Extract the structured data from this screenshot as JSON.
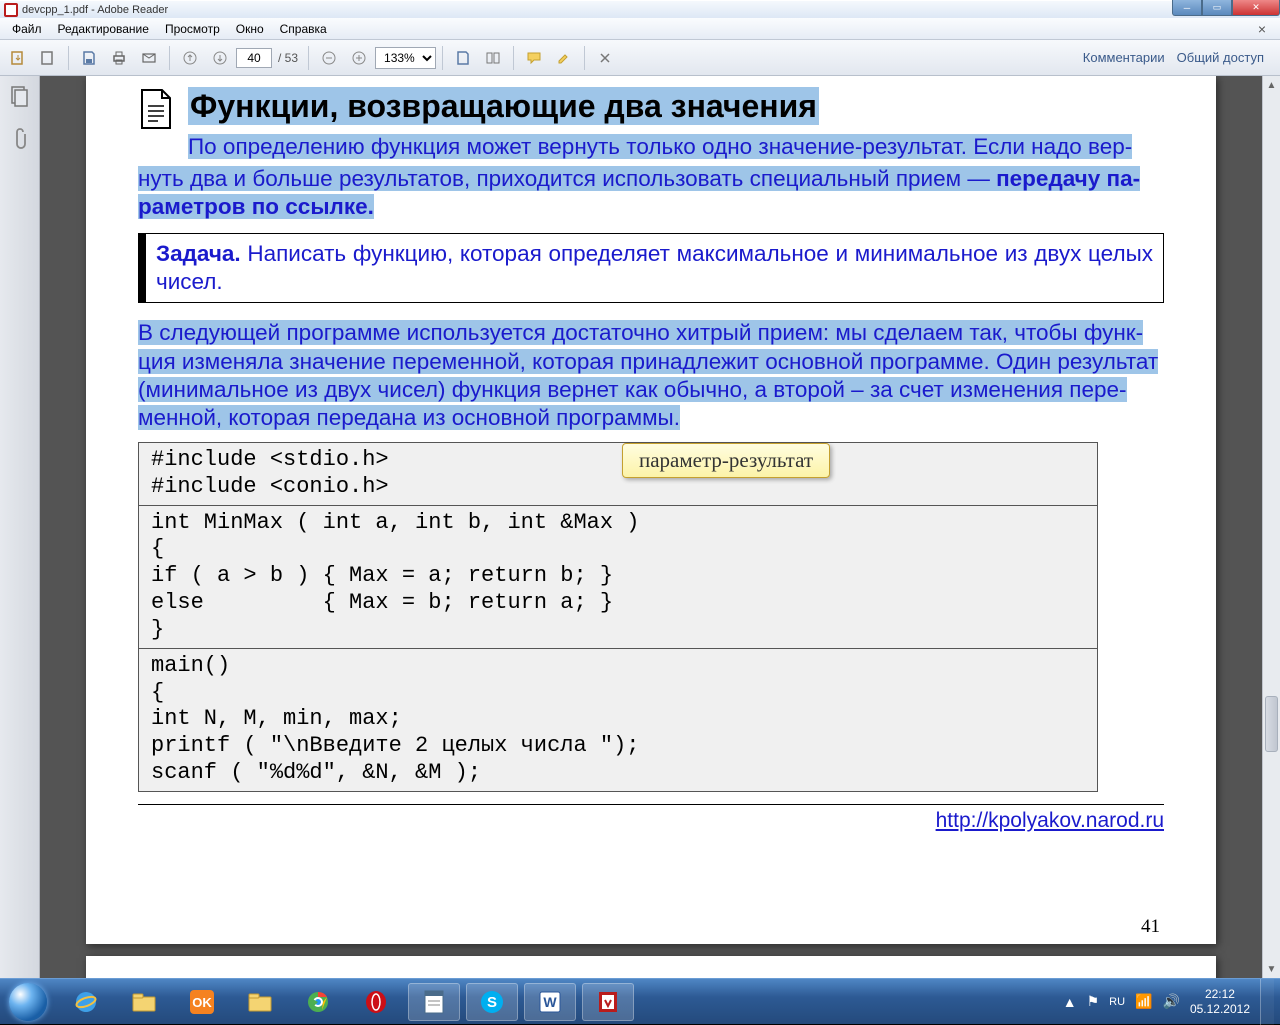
{
  "window": {
    "title": "devcpp_1.pdf - Adobe Reader"
  },
  "menu": {
    "file": "Файл",
    "edit": "Редактирование",
    "view": "Просмотр",
    "window": "Окно",
    "help": "Справка"
  },
  "toolbar": {
    "page_current": "40",
    "page_total": "/ 53",
    "zoom": "133%",
    "comments": "Комментарии",
    "share": "Общий доступ"
  },
  "doc": {
    "heading": "Функции, возвращающие два значения",
    "para1_a": "По определению функция может вернуть только одно значение-результат. Если надо вер-",
    "para1_b": "нуть два и больше результатов, приходится использовать специальный прием — ",
    "para1_bold": "передачу па-",
    "para1_c": "раметров по ссылке.",
    "task_label": "Задача.",
    "task_text": " Написать функцию, которая определяет максимальное и минимальное из двух целых чисел.",
    "para2_a": "В следующей программе используется достаточно хитрый прием: мы сделаем так, чтобы функ-",
    "para2_b": "ция изменяла значение переменной, которая принадлежит основной программе. Один результат",
    "para2_c": "(минимальное из двух чисел) функция вернет как обычно, а второй – за счет изменения пере-",
    "para2_d": "менной, которая передана из основной программы.",
    "callout": "параметр-результат",
    "code1": "#include <stdio.h>\n#include <conio.h>",
    "code2": "int MinMax ( int a, int b, int &Max )\n{\nif ( a > b ) { Max = a; return b; }\nelse         { Max = b; return a; }\n}",
    "code3": "main()\n{\nint N, M, min, max;\nprintf ( \"\\nВведите 2 целых числа \");\nscanf ( \"%d%d\", &N, &M );",
    "footer_url": "http://kpolyakov.narod.ru",
    "pagenum": "41"
  },
  "tray": {
    "lang": "RU",
    "time": "22:12",
    "date": "05.12.2012"
  }
}
